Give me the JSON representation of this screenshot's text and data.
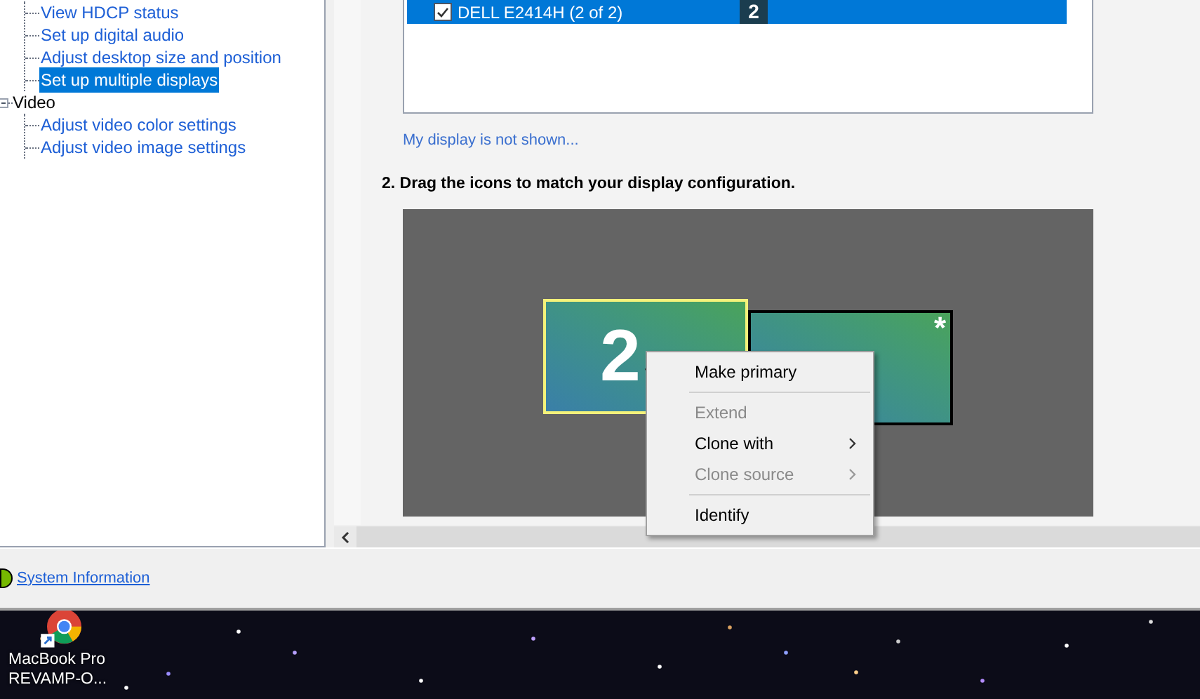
{
  "tree": [
    {
      "children": [
        {
          "label": "View HDCP status",
          "selected": false
        },
        {
          "label": "Set up digital audio",
          "selected": false
        },
        {
          "label": "Adjust desktop size and position",
          "selected": false
        },
        {
          "label": "Set up multiple displays",
          "selected": true
        }
      ]
    },
    {
      "label": "Video",
      "expanded": true,
      "children": [
        {
          "label": "Adjust video color settings",
          "selected": false
        },
        {
          "label": "Adjust video image settings",
          "selected": false
        }
      ]
    }
  ],
  "display_list": [
    {
      "name": "DELL E2414H (2 of 2)",
      "checked": true,
      "selected": true,
      "badge": "2"
    }
  ],
  "missing_display_link": "My display is not shown...",
  "step_heading": "2. Drag the icons to match your display configuration.",
  "displays": [
    {
      "number": "2",
      "selected": true,
      "primary": false
    },
    {
      "selected": false,
      "primary": true,
      "primary_mark": "*"
    }
  ],
  "context_menu": [
    {
      "kind": "item",
      "label": "Make primary",
      "disabled": false,
      "submenu": false
    },
    {
      "kind": "separator"
    },
    {
      "kind": "item",
      "label": "Extend",
      "disabled": true,
      "submenu": false
    },
    {
      "kind": "item",
      "label": "Clone with",
      "disabled": false,
      "submenu": true
    },
    {
      "kind": "item",
      "label": "Clone source",
      "disabled": true,
      "submenu": true
    },
    {
      "kind": "separator"
    },
    {
      "kind": "item",
      "label": "Identify",
      "disabled": false,
      "submenu": false
    }
  ],
  "status_link": "System Information",
  "desktop_icon": {
    "label_lines": [
      "MacBook Pro",
      "REVAMP-O..."
    ]
  }
}
